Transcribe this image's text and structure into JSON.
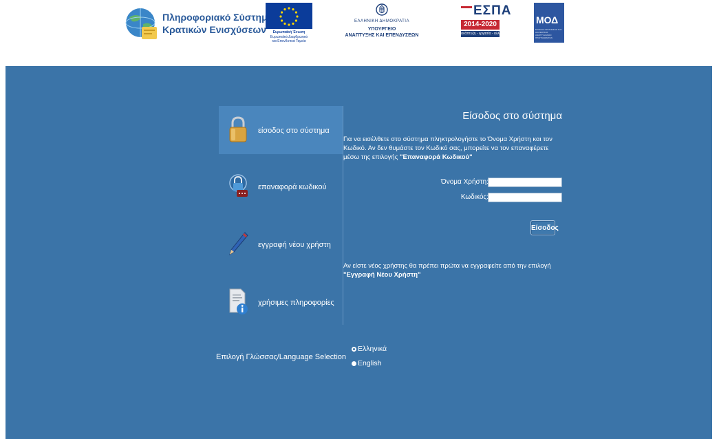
{
  "header": {
    "logo_ps": {
      "line1": "Πληροφοριακό Σύστημα",
      "line2": "Κρατικών Ενισχύσεων"
    },
    "logo_eu": {
      "line1": "Ευρωπαϊκή Ένωση",
      "line2": "Ευρωπαϊκό Διαρθρωτικό",
      "line3": "και Επενδυτικά Ταμεία"
    },
    "logo_gr": {
      "line1": "ΕΛΛΗΝΙΚΗ ΔΗΜΟΚΡΑΤΙΑ",
      "line2": "ΥΠΟΥΡΓΕΙΟ",
      "line3": "ΑΝΑΠΤΥΞΗΣ ΚΑΙ ΕΠΕΝΔΥΣΕΩΝ"
    },
    "logo_espa": {
      "title": "ΕΣΠΑ",
      "years": "2014-2020",
      "tagline": "ανάπτυξη - εργασία - αλληλεγγύη"
    },
    "logo_moa": {
      "title": "ΜΟΔ",
      "subtitle": "ΜΟΝΑΔΑ ΟΡΓΑΝΩΣΗΣ ΤΗΣ ΔΙΑΧΕΙΡΙΣΗΣ ΑΝΑΠΤΥΞΙΑΚΩΝ ΠΡΟΓΡΑΜΜΑΤΩΝ"
    }
  },
  "sidebar": {
    "items": [
      {
        "label": "είσοδος στο σύστημα",
        "icon": "padlock-icon",
        "active": true
      },
      {
        "label": "επαναφορά κωδικού",
        "icon": "reset-password-icon",
        "active": false
      },
      {
        "label": "εγγραφή νέου χρήστη",
        "icon": "pencil-icon",
        "active": false
      },
      {
        "label": "χρήσιμες πληροφορίες",
        "icon": "info-document-icon",
        "active": false
      }
    ]
  },
  "login": {
    "title": "Είσοδος στο σύστημα",
    "intro_text": "Για να εισέλθετε στο σύστημα πληκτρολογήστε το Όνομα Χρήστη και τον Κωδικό. Αν δεν θυμάστε τον Κωδικό σας, μπορείτε να τον επαναφέρετε μέσω της επιλογής ",
    "intro_link": "\"Επαναφορά Κωδικού\"",
    "username_label": "Όνομα Χρήστη:",
    "username_value": "",
    "password_label": "Κωδικός:",
    "password_value": "",
    "submit_label": "Είσοδος",
    "newuser_text": "Αν είστε νέος χρήστης θα πρέπει πρώτα να εγγραφείτε από την επιλογή ",
    "newuser_link": "\"Εγγραφή Νέου Χρήστη\""
  },
  "language": {
    "label": "Επιλογή Γλώσσας/Language Selection",
    "options": [
      {
        "label": "Ελληνικά",
        "selected": true
      },
      {
        "label": "English",
        "selected": false
      }
    ]
  },
  "colors": {
    "panel": "#3b74a8",
    "active_item": "#4a86bd",
    "text": "#ffffff"
  }
}
